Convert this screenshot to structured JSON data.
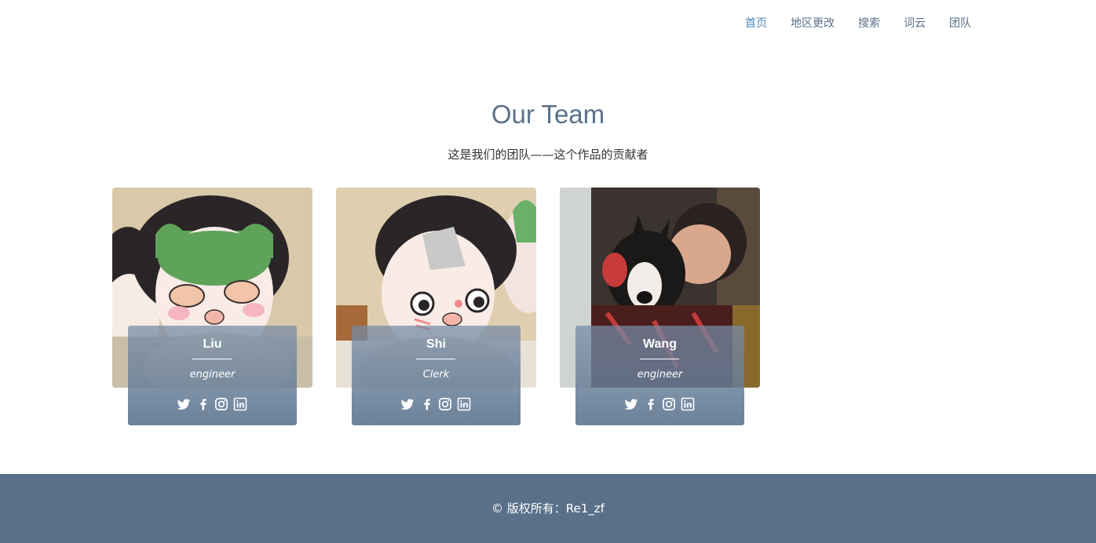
{
  "nav": {
    "items": [
      {
        "label": "首页",
        "active": true
      },
      {
        "label": "地区更改"
      },
      {
        "label": "搜索"
      },
      {
        "label": "词云"
      },
      {
        "label": "团队"
      }
    ]
  },
  "section": {
    "title": "Our Team",
    "subtitle": "这是我们的团队——这个作品的贡献者"
  },
  "team": [
    {
      "name": "Liu",
      "role": "engineer",
      "social_icons": [
        "twitter-icon",
        "facebook-icon",
        "instagram-icon",
        "linkedin-icon"
      ]
    },
    {
      "name": "Shi",
      "role": "Clerk",
      "social_icons": [
        "twitter-icon",
        "facebook-icon",
        "instagram-icon",
        "linkedin-icon"
      ]
    },
    {
      "name": "Wang",
      "role": "engineer",
      "social_icons": [
        "twitter-icon",
        "facebook-icon",
        "instagram-icon",
        "linkedin-icon"
      ]
    }
  ],
  "footer": {
    "copyright": "© 版权所有：Re1_zf"
  },
  "colors": {
    "brand": "#5a7089",
    "nav_active": "#4b87b5",
    "card_overlay": "#6f859e"
  }
}
